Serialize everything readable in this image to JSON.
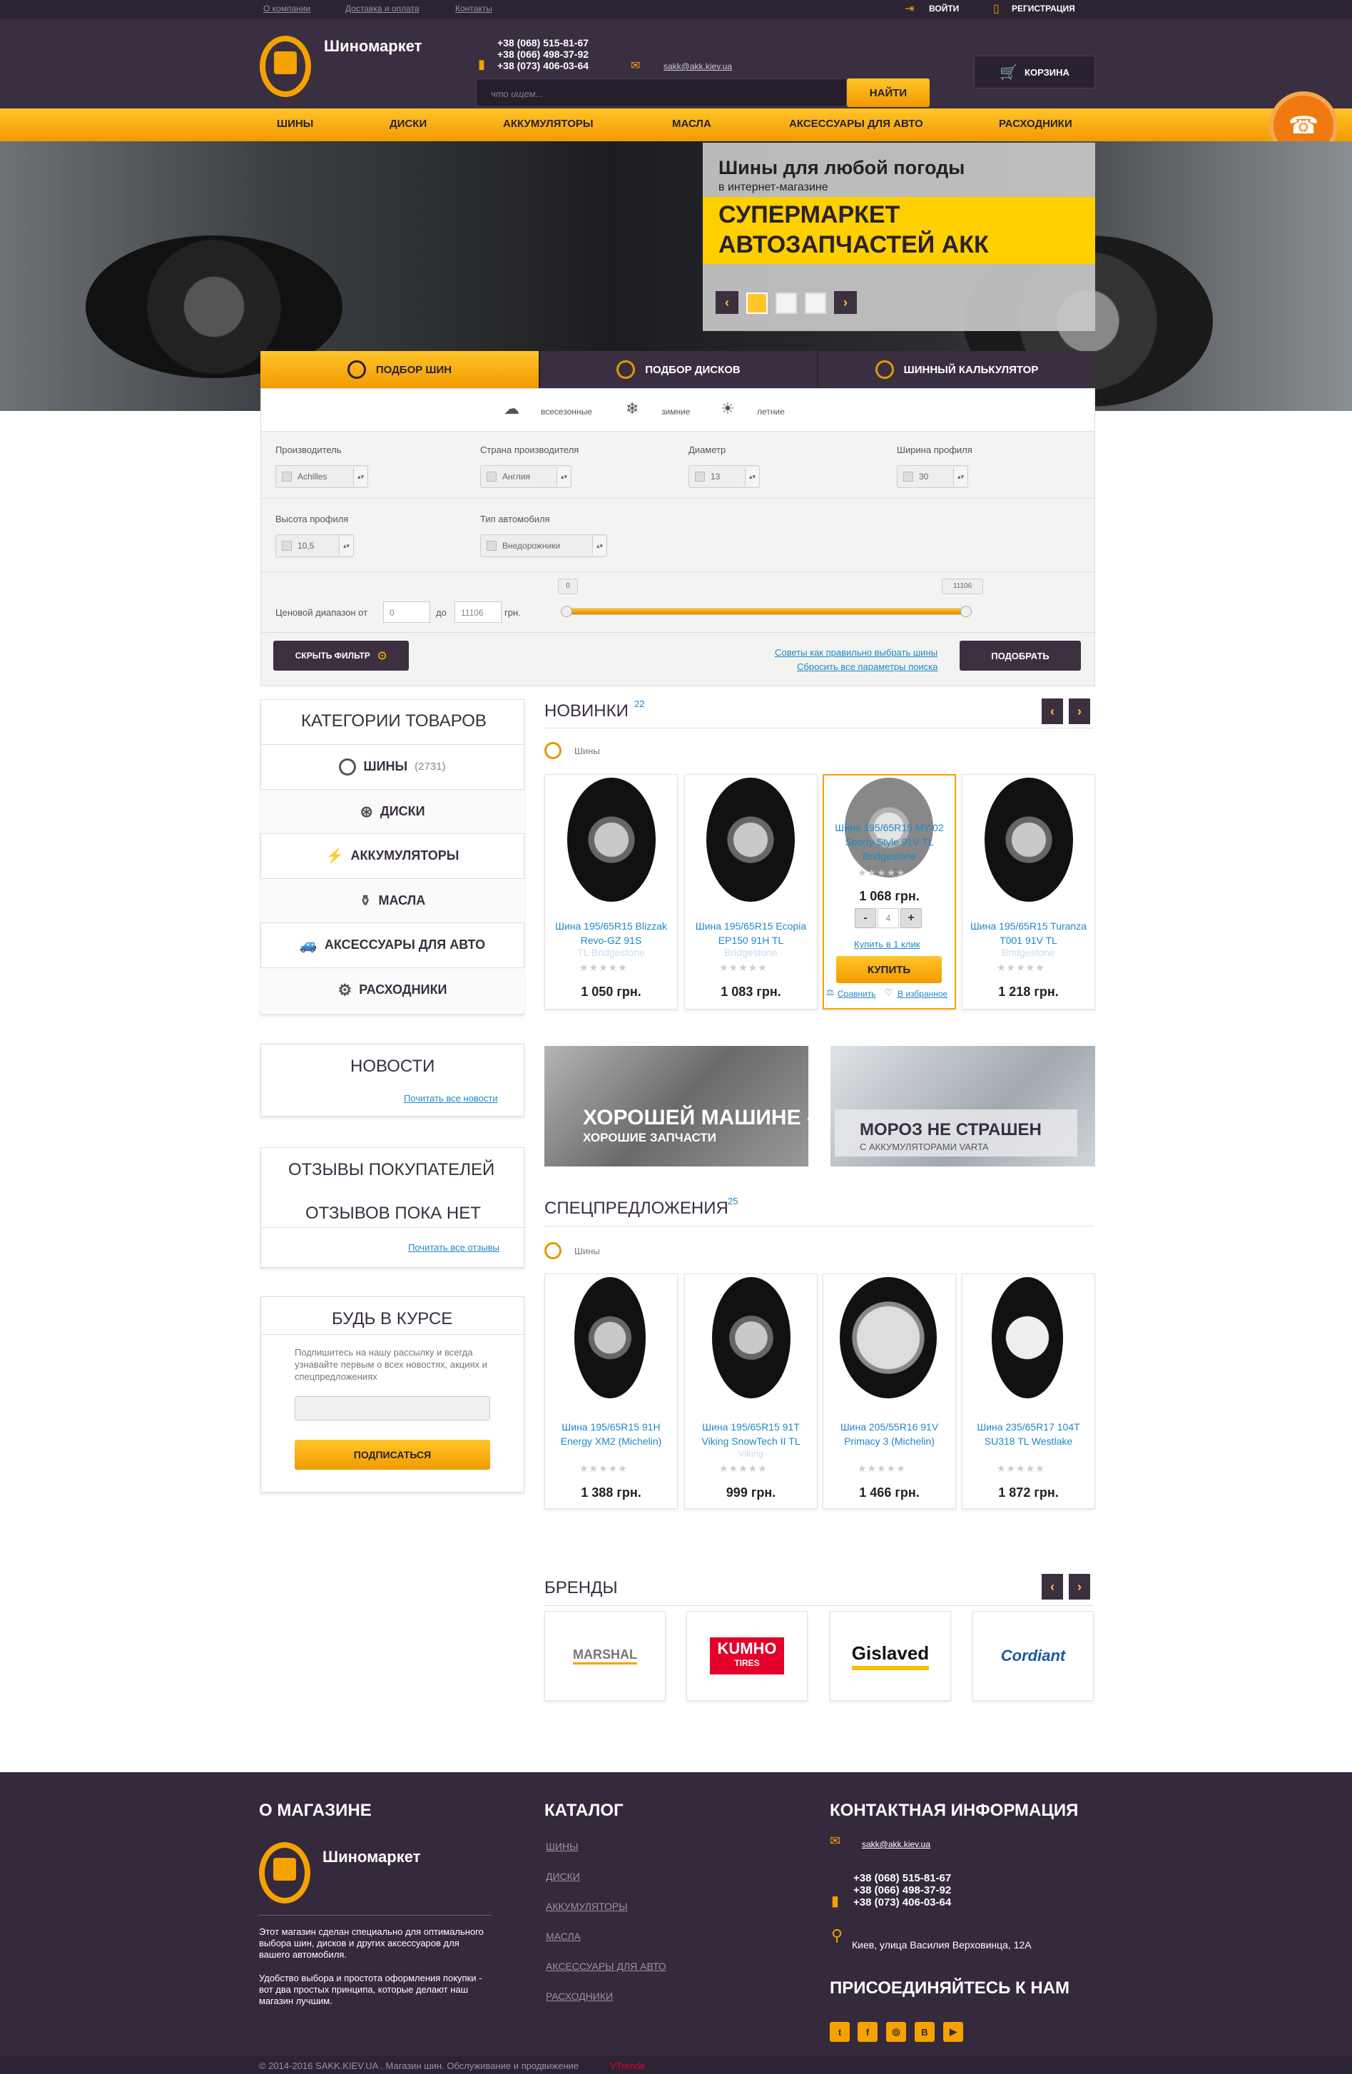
{
  "topbar": {
    "links": [
      "О компании",
      "Доставка и оплата",
      "Контакты"
    ],
    "login": "ВОЙТИ",
    "register": "РЕГИСТРАЦИЯ"
  },
  "header": {
    "brand": "Шиномаркет",
    "phones": [
      "+38 (068) 515-81-67",
      "+38 (066) 498-37-92",
      "+38 (073) 406-03-64"
    ],
    "email": "sakk@akk.kiev.ua",
    "search_placeholder": "что ищем...",
    "search_button": "НАЙТИ",
    "cart": "КОРЗИНА"
  },
  "nav": [
    "ШИНЫ",
    "ДИСКИ",
    "АККУМУЛЯТОРЫ",
    "МАСЛА",
    "АКСЕССУАРЫ ДЛЯ АВТО",
    "РАСХОДНИКИ"
  ],
  "slider": {
    "line1": "Шины для любой погоды",
    "line2": "в интернет-магазине",
    "line3": "СУПЕРМАРКЕТ",
    "line4": "АВТОЗАПЧАСТЕЙ АКК",
    "prev": "‹",
    "next": "›"
  },
  "tabs": [
    "ПОДБОР ШИН",
    "ПОДБОР ДИСКОВ",
    "ШИННЫЙ КАЛЬКУЛЯТОР"
  ],
  "seasons": [
    "всесезонные",
    "зимние",
    "летние"
  ],
  "filters": {
    "manufacturer": {
      "label": "Производитель",
      "value": "Achilles"
    },
    "country": {
      "label": "Страна производителя",
      "value": "Англия"
    },
    "diameter": {
      "label": "Диаметр",
      "value": "13"
    },
    "width": {
      "label": "Ширина профиля",
      "value": "30"
    },
    "height": {
      "label": "Высота профиля",
      "value": "10,5"
    },
    "car_type": {
      "label": "Тип автомобиля",
      "value": "Внедорожники"
    },
    "price_label": "Ценовой диапазон от",
    "price_from": "0",
    "price_to_label": "до",
    "price_to": "11106",
    "currency": "грн.",
    "slider_min": "0",
    "slider_max": "11106",
    "hide_filter": "СКРЫТЬ ФИЛЬТР",
    "tip": "Советы как правильно выбрать шины",
    "reset": "Сбросить все параметры поиска",
    "pick": "ПОДОБРАТЬ"
  },
  "categories": {
    "title": "КАТЕГОРИИ ТОВАРОВ",
    "items": [
      {
        "label": "ШИНЫ",
        "count": "(2731)"
      },
      {
        "label": "ДИСКИ",
        "count": ""
      },
      {
        "label": "АККУМУЛЯТОРЫ",
        "count": ""
      },
      {
        "label": "МАСЛА",
        "count": ""
      },
      {
        "label": "АКСЕССУАРЫ ДЛЯ АВТО",
        "count": ""
      },
      {
        "label": "РАСХОДНИКИ",
        "count": ""
      }
    ]
  },
  "news_box": {
    "title": "НОВОСТИ",
    "link": "Почитать все новости"
  },
  "reviews_box": {
    "title": "ОТЗЫВЫ ПОКУПАТЕЛЕЙ",
    "empty": "ОТЗЫВОВ ПОКА НЕТ",
    "link": "Почитать все отзывы"
  },
  "subscribe": {
    "title": "БУДЬ В КУРСЕ",
    "text": "Подпишитесь на нашу рассылку и всегда узнавайте первым о всех новостях, акциях и спецпредложениях",
    "button": "ПОДПИСАТЬСЯ"
  },
  "new_products": {
    "title": "НОВИНКИ",
    "count": "22",
    "category": "Шины",
    "items": [
      {
        "name": "Шина 195/65R15 Blizzak Revo-GZ 91S",
        "sub": "TL Bridgestone",
        "price": "1 050 грн."
      },
      {
        "name": "Шина 195/65R15 Ecopia EP150 91H TL",
        "sub": "Bridgestone",
        "price": "1 083 грн."
      },
      {
        "name": "Шина 195/65R15 MY-02 Sporty Style 91V TL Bridgestone",
        "sub": "",
        "price": "1 068 грн.",
        "qty": "4",
        "quick": "Купить в 1 клик",
        "buy": "КУПИТЬ",
        "compare": "Сравнить",
        "fav": "В избранное"
      },
      {
        "name": "Шина 195/65R15 Turanza T001 91V TL",
        "sub": "Bridgestone",
        "price": "1 218 грн."
      }
    ]
  },
  "banners": [
    {
      "title": "ХОРОШЕЙ МАШИНЕ -",
      "sub": "ХОРОШИЕ ЗАПЧАСТИ"
    },
    {
      "title": "МОРОЗ НЕ СТРАШЕН",
      "sub": "С АККУМУЛЯТОРАМИ VARTA"
    }
  ],
  "specials": {
    "title": "СПЕЦПРЕДЛОЖЕНИЯ",
    "count": "25",
    "category": "Шины",
    "items": [
      {
        "name": "Шина 195/65R15 91H Energy XM2 (Michelin)",
        "price": "1 388 грн."
      },
      {
        "name": "Шина 195/65R15 91T Viking SnowTech II TL",
        "sub": "Viking",
        "price": "999 грн."
      },
      {
        "name": "Шина 205/55R16 91V Primacy 3 (Michelin)",
        "price": "1 466 грн."
      },
      {
        "name": "Шина 235/65R17 104T SU318 TL Westlake",
        "price": "1 872 грн."
      }
    ]
  },
  "brands": {
    "title": "БРЕНДЫ",
    "items": [
      "MARSHAL",
      "KUMHO",
      "Gislaved",
      "Cordiant"
    ],
    "kumho_sub": "TIRES"
  },
  "footer": {
    "about_title": "О МАГАЗИНЕ",
    "brand": "Шиномаркет",
    "about1": "Этот магазин сделан специально для оптимального выбора шин, дисков и других аксессуаров для вашего автомобиля.",
    "about2": "Удобство выбора и простота оформления покупки - вот два простых принципа, которые делают наш магазин лучшим.",
    "catalog_title": "КАТАЛОГ",
    "catalog": [
      "ШИНЫ",
      "ДИСКИ",
      "АККУМУЛЯТОРЫ",
      "МАСЛА",
      "АКСЕССУАРЫ ДЛЯ АВТО",
      "РАСХОДНИКИ"
    ],
    "contact_title": "КОНТАКТНАЯ ИНФОРМАЦИЯ",
    "email": "sakk@akk.kiev.ua",
    "phones": [
      "+38 (068) 515-81-67",
      "+38 (066) 498-37-92",
      "+38 (073) 406-03-64"
    ],
    "address": "Киев, улица Василия Верховинца, 12А",
    "join_title": "ПРИСОЕДИНЯЙТЕСЬ К НАМ",
    "copyright": "© 2014-2016 SAKK.KIEV.UA . Магазин шин. Обслуживание и продвижение",
    "vendor": "VTrende"
  },
  "colors": {
    "accent": "#f5a200",
    "dark": "#3a2f40",
    "link": "#1e88c8"
  }
}
